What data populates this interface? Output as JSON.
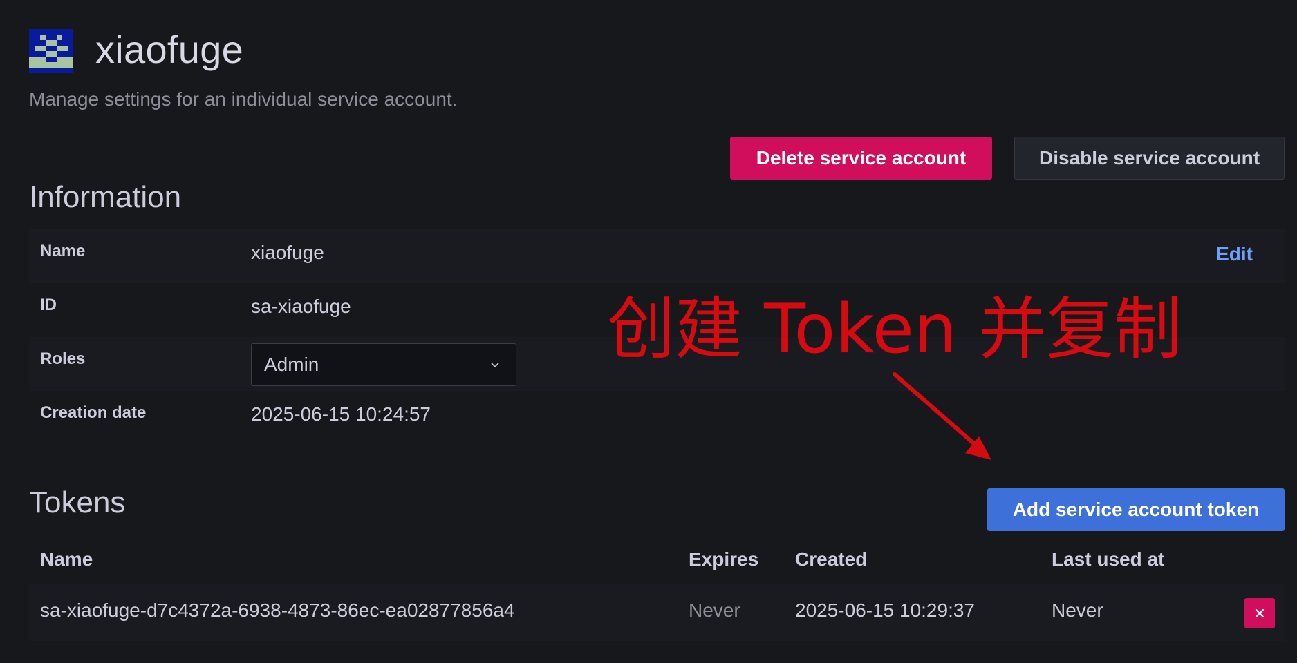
{
  "header": {
    "title": "xiaofuge",
    "subtitle": "Manage settings for an individual service account.",
    "avatar_icon": "identicon-avatar"
  },
  "actions": {
    "delete_label": "Delete service account",
    "disable_label": "Disable service account"
  },
  "information": {
    "title": "Information",
    "rows": [
      {
        "label": "Name",
        "value": "xiaofuge"
      },
      {
        "label": "ID",
        "value": "sa-xiaofuge"
      },
      {
        "label": "Roles",
        "value": "Admin"
      },
      {
        "label": "Creation date",
        "value": "2025-06-15 10:24:57"
      }
    ],
    "edit_label": "Edit"
  },
  "annotation": {
    "text": "创建 Token 并复制"
  },
  "tokens": {
    "title": "Tokens",
    "add_label": "Add service account token",
    "columns": [
      "Name",
      "Expires",
      "Created",
      "Last used at"
    ],
    "rows": [
      {
        "name": "sa-xiaofuge-d7c4372a-6938-4873-86ec-ea02877856a4",
        "expires": "Never",
        "created": "2025-06-15 10:29:37",
        "last_used": "Never"
      }
    ]
  },
  "colors": {
    "background": "#17181c",
    "danger": "#d10e5c",
    "primary": "#3d71d9",
    "link": "#6e9fff",
    "annotation": "#d60b11"
  }
}
